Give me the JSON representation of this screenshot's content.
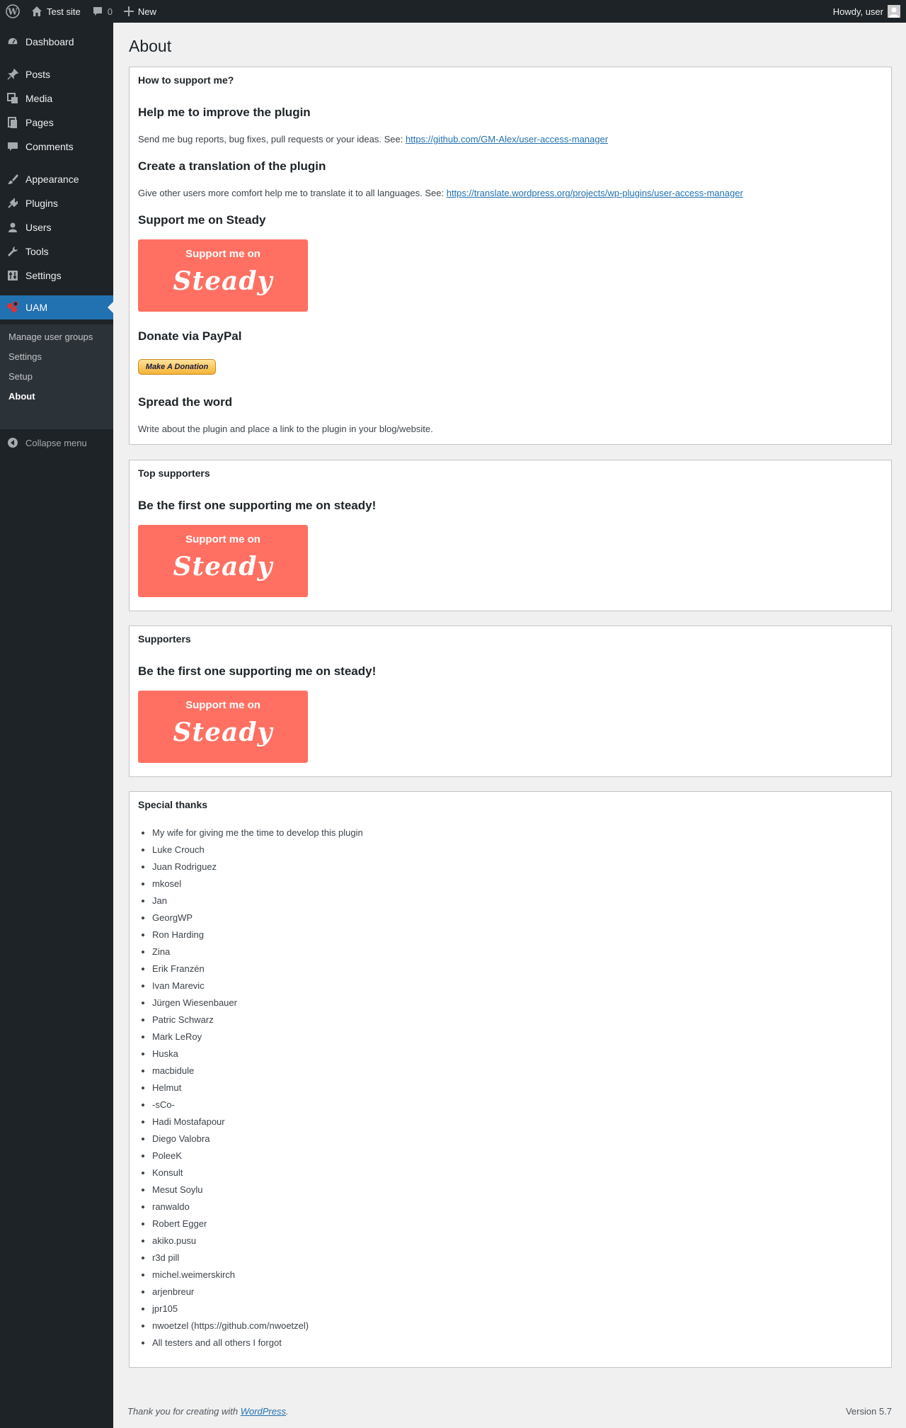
{
  "adminbar": {
    "site_name": "Test site",
    "comments_count": "0",
    "new_label": "New",
    "howdy": "Howdy, user"
  },
  "sidebar": {
    "items": [
      {
        "label": "Dashboard",
        "icon": "dashboard-icon"
      },
      {
        "label": "Posts",
        "icon": "pin-icon"
      },
      {
        "label": "Media",
        "icon": "media-icon"
      },
      {
        "label": "Pages",
        "icon": "pages-icon"
      },
      {
        "label": "Comments",
        "icon": "comment-icon"
      },
      {
        "label": "Appearance",
        "icon": "brush-icon"
      },
      {
        "label": "Plugins",
        "icon": "plugin-icon"
      },
      {
        "label": "Users",
        "icon": "user-icon"
      },
      {
        "label": "Tools",
        "icon": "wrench-icon"
      },
      {
        "label": "Settings",
        "icon": "settings-icon"
      },
      {
        "label": "UAM",
        "icon": "uam-icon"
      }
    ],
    "submenu": [
      "Manage user groups",
      "Settings",
      "Setup",
      "About"
    ],
    "collapse": "Collapse menu"
  },
  "page": {
    "title": "About",
    "support_box": {
      "title": "How to support me?",
      "improve_heading": "Help me to improve the plugin",
      "improve_text": "Send me bug reports, bug fixes, pull requests or your ideas. See: ",
      "improve_link": "https://github.com/GM-Alex/user-access-manager",
      "translate_heading": "Create a translation of the plugin",
      "translate_text": "Give other users more comfort help me to translate it to all languages. See: ",
      "translate_link": "https://translate.wordpress.org/projects/wp-plugins/user-access-manager",
      "steady_heading": "Support me on Steady",
      "paypal_heading": "Donate via PayPal",
      "donate_button": "Make A Donation",
      "spread_heading": "Spread the word",
      "spread_text": "Write about the plugin and place a link to the plugin in your blog/website."
    },
    "steady_button": {
      "top": "Support me on",
      "big": "Steady"
    },
    "top_supporters": {
      "title": "Top supporters",
      "heading": "Be the first one supporting me on steady!"
    },
    "supporters": {
      "title": "Supporters",
      "heading": "Be the first one supporting me on steady!"
    },
    "special_thanks": {
      "title": "Special thanks",
      "items": [
        "My wife for giving me the time to develop this plugin",
        "Luke Crouch",
        "Juan Rodriguez",
        "mkosel",
        "Jan",
        "GeorgWP",
        "Ron Harding",
        "Zina",
        "Erik Franzén",
        "Ivan Marevic",
        "Jürgen Wiesenbauer",
        "Patric Schwarz",
        "Mark LeRoy",
        "Huska",
        "macbidule",
        "Helmut",
        "-sCo-",
        "Hadi Mostafapour",
        "Diego Valobra",
        "PoleeK",
        "Konsult",
        "Mesut Soylu",
        "ranwaldo",
        "Robert Egger",
        "akiko.pusu",
        "r3d pill",
        "michel.weimerskirch",
        "arjenbreur",
        "jpr105",
        "nwoetzel (https://github.com/nwoetzel)",
        "All testers and all others I forgot"
      ]
    }
  },
  "footer": {
    "thanks_prefix": "Thank you for creating with ",
    "thanks_link": "WordPress",
    "thanks_suffix": ".",
    "version": "Version 5.7"
  },
  "colors": {
    "admin_dark": "#1d2327",
    "accent": "#2271b1",
    "steady": "#ff7062"
  }
}
